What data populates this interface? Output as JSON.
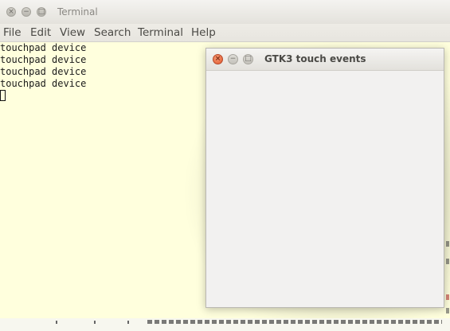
{
  "terminal": {
    "title": "Terminal",
    "controls": {
      "close": "×",
      "minimize": "−",
      "maximize": "□"
    },
    "menu": [
      "File",
      "Edit",
      "View",
      "Search",
      "Terminal",
      "Help"
    ],
    "output_lines": [
      "touchpad device",
      "touchpad device",
      "touchpad device",
      "touchpad device"
    ]
  },
  "gtk_window": {
    "title": "GTK3 touch events",
    "controls": {
      "close": "×",
      "minimize": "−",
      "maximize": "□"
    }
  },
  "colors": {
    "terminal_bg": "#ffffdd",
    "window_bg": "#f2f1f0",
    "close_button": "#e2582e"
  }
}
